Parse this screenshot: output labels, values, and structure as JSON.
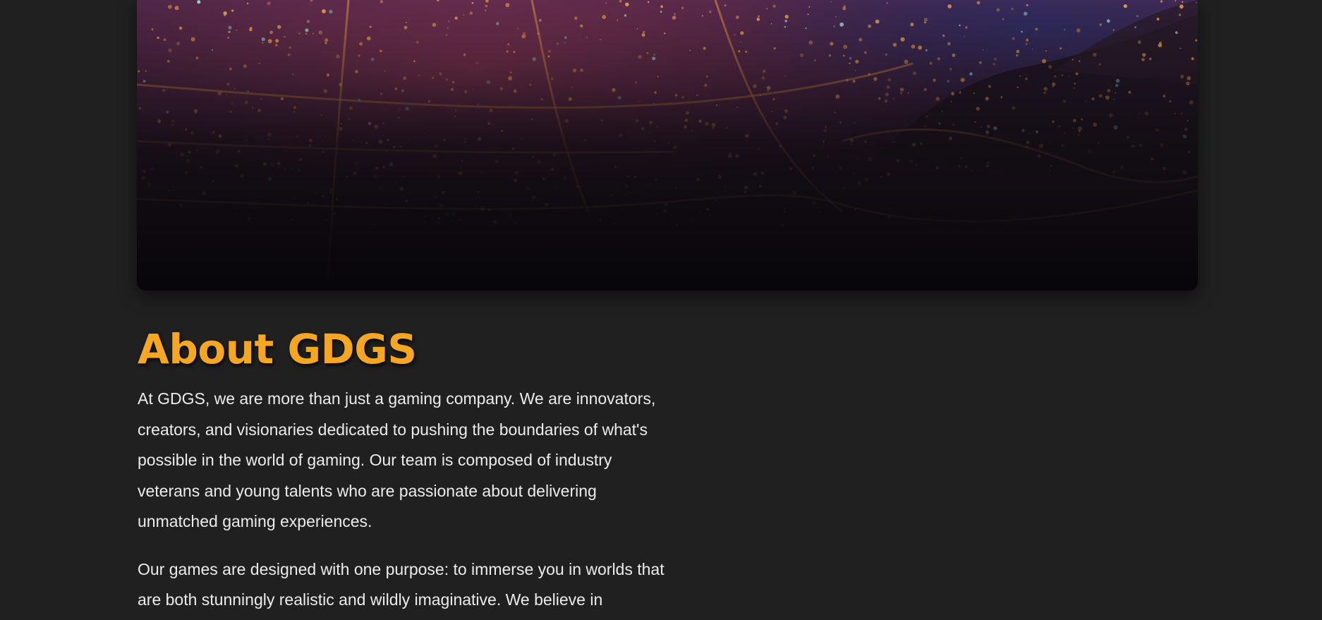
{
  "hero": {
    "image": "night-city-aerial-image",
    "colors": {
      "sky_top": "#3b1f45",
      "city_glow": "#f0a04a",
      "hills": "#1b1420",
      "foreground": "#0d0a0f"
    }
  },
  "about": {
    "title": "About GDGS",
    "paragraphs": [
      "At GDGS, we are more than just a gaming company. We are innovators, creators, and visionaries dedicated to pushing the boundaries of what's possible in the world of gaming. Our team is composed of industry veterans and young talents who are passionate about delivering unmatched gaming experiences.",
      "Our games are designed with one purpose: to immerse you in worlds that are both stunningly realistic and wildly imaginative. We believe in"
    ]
  },
  "theme": {
    "background": "#202020",
    "accent": "#f5a623",
    "text": "#ececec"
  }
}
